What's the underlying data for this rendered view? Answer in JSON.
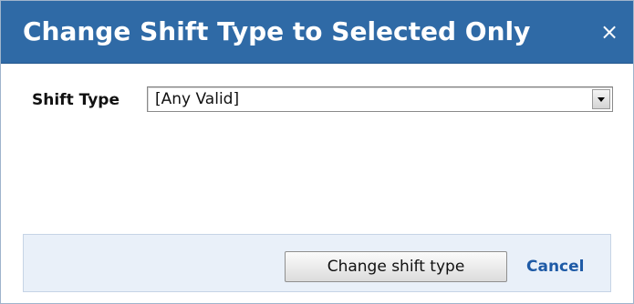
{
  "dialog": {
    "title": "Change Shift Type to Selected Only",
    "close_glyph": "×",
    "close_icon": "close-icon"
  },
  "form": {
    "shift_type_label": "Shift Type",
    "shift_type_value": "[Any Valid]",
    "dropdown_icon": "chevron-down-icon"
  },
  "footer": {
    "primary_button_label": "Change shift type",
    "cancel_link_label": "Cancel"
  },
  "colors": {
    "titlebar": "#2f6aa6",
    "footer_bg": "#e9f0f9",
    "link": "#1e5aa6"
  }
}
